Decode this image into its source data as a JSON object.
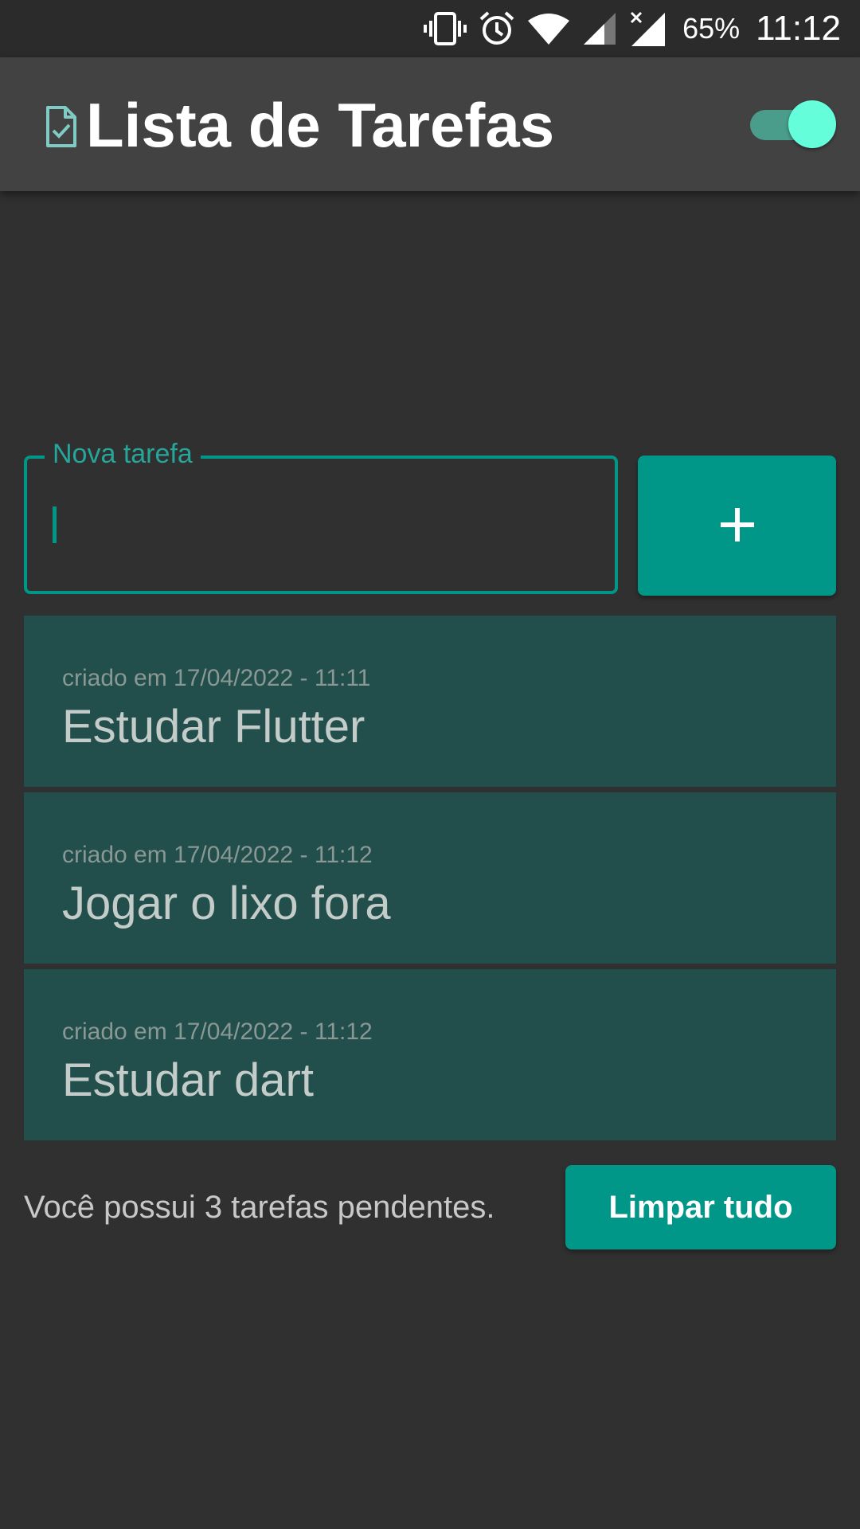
{
  "status_bar": {
    "battery": "65%",
    "time": "11:12",
    "icons": [
      "vibrate-icon",
      "alarm-icon",
      "wifi-icon",
      "signal-icon",
      "signal-no-data-icon"
    ]
  },
  "app_bar": {
    "title": "Lista de Tarefas",
    "icon": "task-document-check-icon",
    "theme_toggle_on": true
  },
  "input": {
    "label": "Nova tarefa",
    "value": ""
  },
  "add_button": {
    "icon": "plus-icon"
  },
  "tasks": [
    {
      "date": "criado em 17/04/2022 - 11:11",
      "title": "Estudar Flutter"
    },
    {
      "date": "criado em 17/04/2022 - 11:12",
      "title": "Jogar o lixo fora"
    },
    {
      "date": "criado em 17/04/2022 - 11:12",
      "title": "Estudar dart"
    }
  ],
  "footer": {
    "pending_text": "Você possui 3 tarefas pendentes.",
    "clear_label": "Limpar tudo"
  },
  "colors": {
    "background": "#303030",
    "app_bar": "#424242",
    "accent": "#009688",
    "toggle_thumb": "#64ffda",
    "task_card": "#224f4b"
  }
}
